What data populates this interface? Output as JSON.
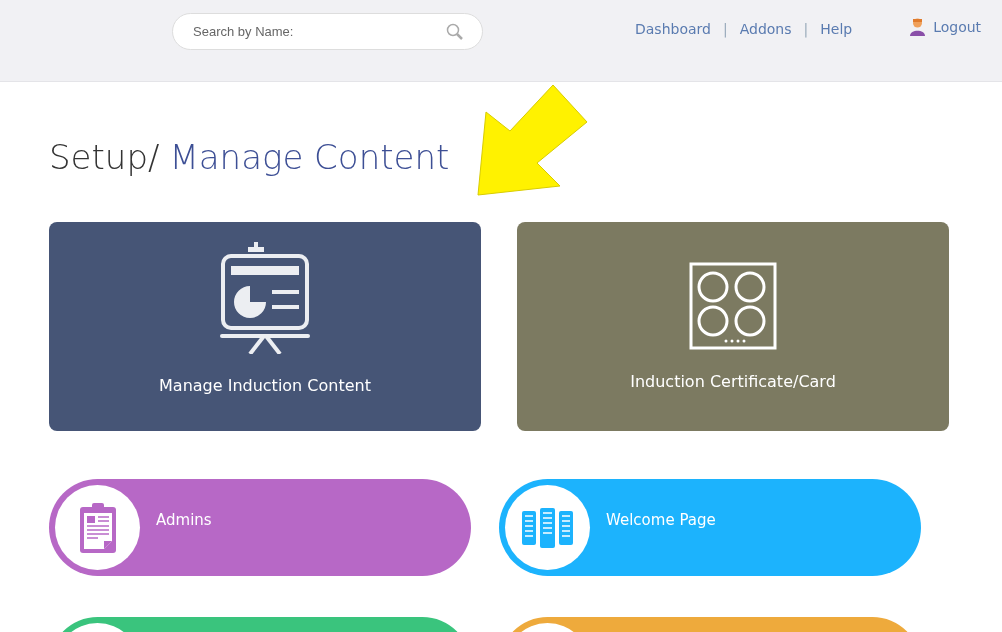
{
  "header": {
    "search": {
      "placeholder": "Search by Name:"
    },
    "nav": [
      "Dashboard",
      "Addons",
      "Help"
    ],
    "separator": "|",
    "logout": "Logout"
  },
  "title": {
    "prefix": "Setup/",
    "main": "Manage Content"
  },
  "cards": [
    {
      "label": "Manage Induction Content",
      "kind": "presentation",
      "color": "#465576"
    },
    {
      "label": "Induction Certificate/Card",
      "kind": "cooktop",
      "color": "#7c7a61"
    }
  ],
  "tiles": [
    {
      "label": "Admins",
      "kind": "clipboard",
      "color": "#b768c6"
    },
    {
      "label": "Welcome Page",
      "kind": "servers",
      "color": "#1cb3fd"
    },
    {
      "color": "#3ac47d"
    },
    {
      "color": "#eeaa3c"
    }
  ]
}
